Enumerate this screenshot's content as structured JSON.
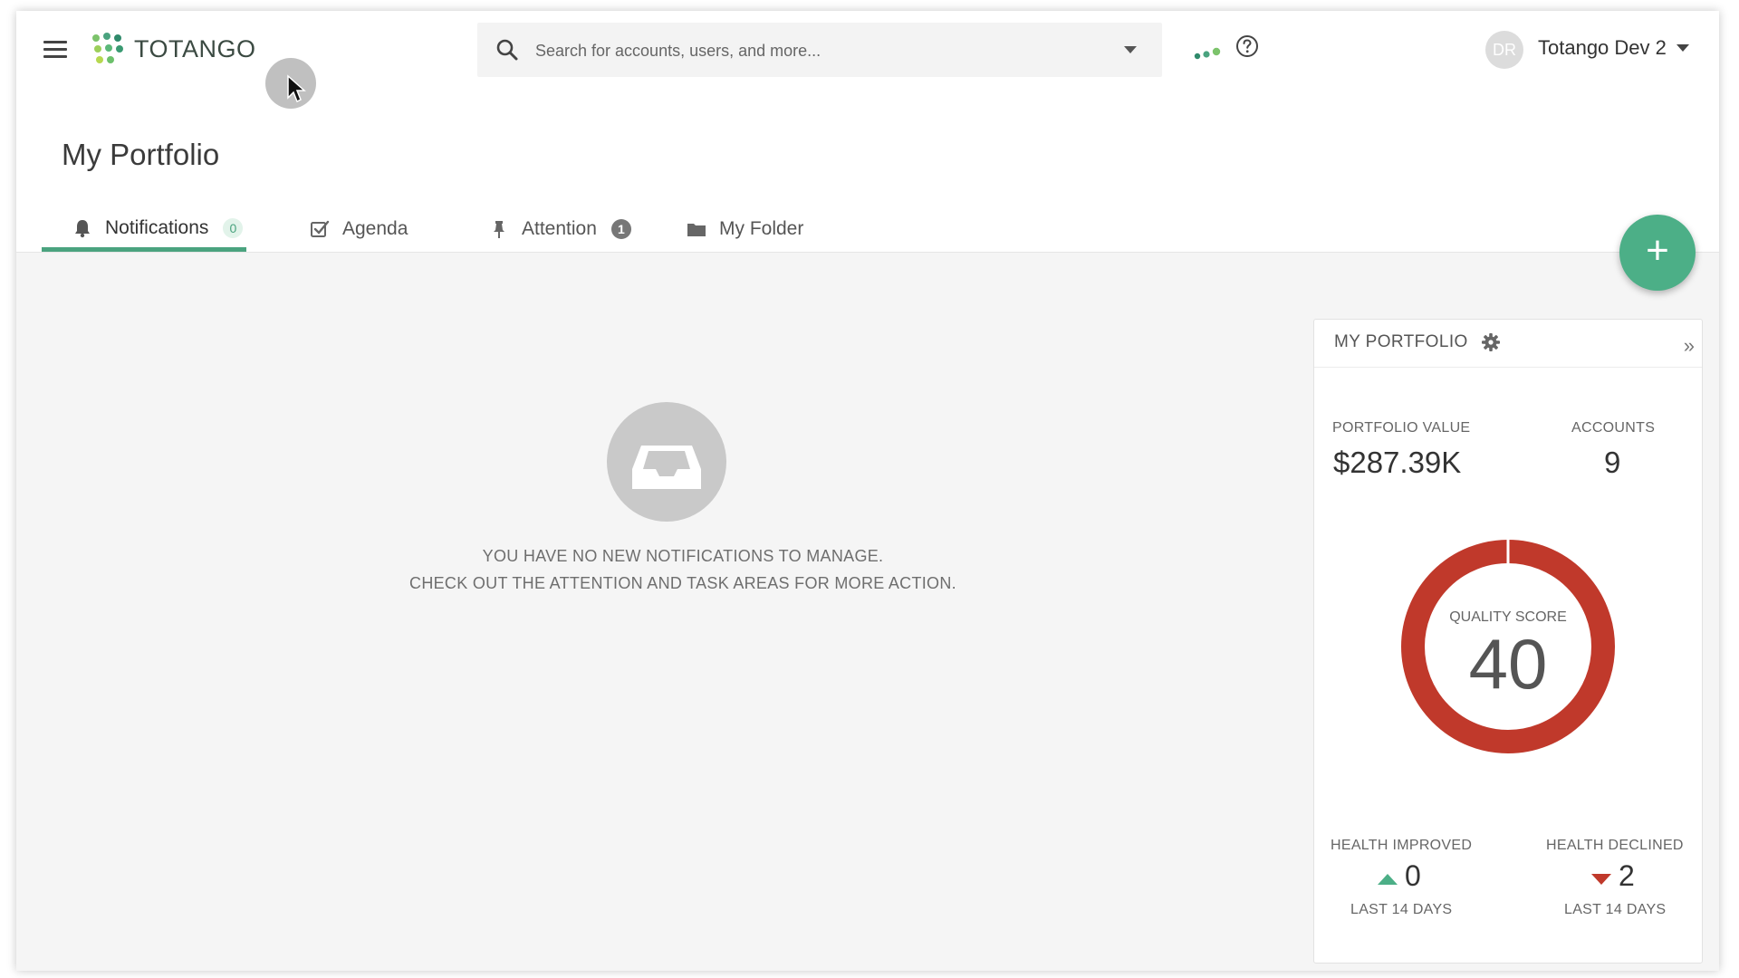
{
  "app": {
    "logo_text": "TOTANGO"
  },
  "search": {
    "placeholder": "Search for accounts, users, and more..."
  },
  "user": {
    "initials": "DR",
    "name": "Totango Dev 2"
  },
  "page": {
    "title": "My Portfolio"
  },
  "tabs": [
    {
      "label": "Notifications",
      "badge": "0",
      "icon": "bell-icon"
    },
    {
      "label": "Agenda",
      "icon": "checkbox-icon"
    },
    {
      "label": "Attention",
      "badge": "1",
      "icon": "pin-icon"
    },
    {
      "label": "My Folder",
      "icon": "folder-icon"
    }
  ],
  "fab": {
    "label": "+"
  },
  "empty_state": {
    "icon": "inbox-icon",
    "line1": "YOU HAVE NO NEW NOTIFICATIONS TO MANAGE.",
    "line2": "CHECK OUT THE ATTENTION AND TASK AREAS FOR MORE ACTION."
  },
  "portfolio_card": {
    "title": "MY PORTFOLIO",
    "expand_label": "»",
    "portfolio_value_label": "PORTFOLIO VALUE",
    "portfolio_value": "$287.39K",
    "accounts_label": "ACCOUNTS",
    "accounts": "9",
    "quality_score_label": "QUALITY SCORE",
    "quality_score": "40",
    "health_improved_label": "HEALTH IMPROVED",
    "health_improved": "0",
    "health_declined_label": "HEALTH DECLINED",
    "health_declined": "2",
    "period_label": "LAST 14 DAYS"
  },
  "colors": {
    "accent_green": "#4aa37f",
    "fab_green": "#4caf87",
    "quality_red": "#c0392b"
  }
}
